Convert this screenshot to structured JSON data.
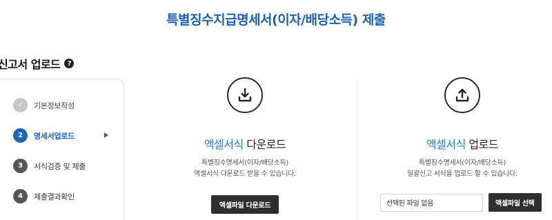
{
  "page": {
    "title": "특별징수지급명세서(이자/배당소득) 제출"
  },
  "section": {
    "title": "신고서 업로드",
    "help_icon": "?"
  },
  "steps": [
    {
      "number": "✓",
      "label": "기본정보작성",
      "state": "done"
    },
    {
      "number": "2",
      "label": "명세서업로드",
      "state": "active"
    },
    {
      "number": "3",
      "label": "서식검증 및 제출",
      "state": "pending"
    },
    {
      "number": "4",
      "label": "제출결과확인",
      "state": "pending"
    }
  ],
  "download": {
    "icon": "download-icon",
    "heading_accent": "액셀서식",
    "heading_rest": " 다운로드",
    "desc_line1": "특별징수명세서(이자/배당소득)",
    "desc_line2": "액셀서식 다운로드 받을 수 있습니다.",
    "button_label": "액셀파일 다운로드"
  },
  "upload": {
    "icon": "upload-icon",
    "heading_accent": "액셀서식",
    "heading_rest": " 업로드",
    "desc_line1": "특별징수명세서(이자/배당소득)",
    "desc_line2": "일괄신고 서식을 업로드 할 수 있습니다.",
    "file_placeholder": "선택된 파일 없음",
    "button_label": "액셀파일 선택"
  },
  "colors": {
    "accent": "#1a63b8",
    "title": "#1f5fb3",
    "button": "#2f2f2f"
  }
}
